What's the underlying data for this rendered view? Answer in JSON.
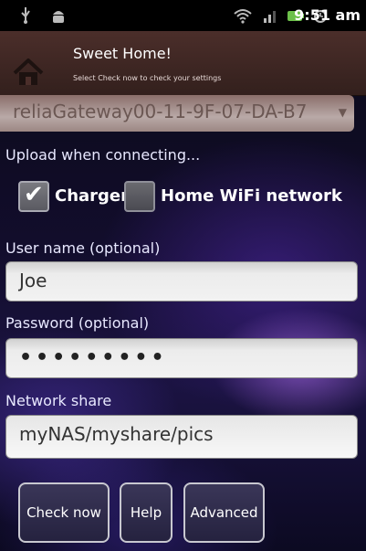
{
  "status_bar": {
    "time": "9:51 am",
    "icons": [
      "usb-icon",
      "android-debug-icon",
      "wifi-icon",
      "signal-icon",
      "battery-icon",
      "alarm-icon"
    ]
  },
  "dialog": {
    "title": "Sweet Home!",
    "subtitle": "Select Check now to check your settings"
  },
  "gateway_spinner": {
    "value": "reliaGateway00-11-9F-07-DA-B7"
  },
  "upload_section": {
    "label": "Upload when connecting...",
    "charger": {
      "label": "Charger",
      "checked": true
    },
    "home_wifi": {
      "label": "Home WiFi network",
      "checked": false
    }
  },
  "username": {
    "label": "User name (optional)",
    "value": "Joe"
  },
  "password": {
    "label": "Password (optional)",
    "value": "•••••••••"
  },
  "network_share": {
    "label": "Network share",
    "value": "myNAS/myshare/pics"
  },
  "buttons": {
    "check_now": "Check now",
    "help": "Help",
    "advanced": "Advanced"
  },
  "colors": {
    "title_bar": "#4b2e2a",
    "label_text": "#e8e8ff",
    "background": "#120d2c"
  }
}
